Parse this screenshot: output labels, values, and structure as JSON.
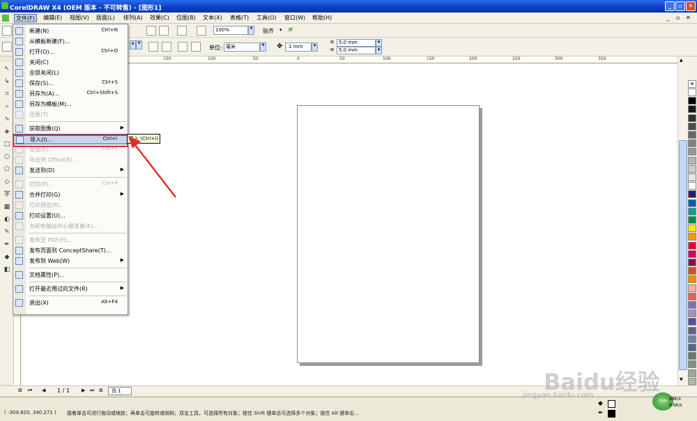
{
  "app": {
    "title": "CorelDRAW X4 (OEM 版本 - 不可转售) - [图形1]"
  },
  "menubar": [
    "文件(F)",
    "编辑(E)",
    "视图(V)",
    "版面(L)",
    "排列(A)",
    "效果(C)",
    "位图(B)",
    "文本(X)",
    "表格(T)",
    "工具(O)",
    "窗口(W)",
    "帮助(H)"
  ],
  "toolbar": {
    "zoom": "100%",
    "snap": "贴齐"
  },
  "propbar": {
    "unit_label": "单位:",
    "unit": "毫米",
    "nudge": ".1 mm",
    "dup_x": "5.0 mm",
    "dup_y": "5.0 mm"
  },
  "file_menu": [
    {
      "label": "新建(N)",
      "shortcut": "Ctrl+N",
      "enabled": true
    },
    {
      "label": "从模板新建(F)...",
      "shortcut": "",
      "enabled": true
    },
    {
      "label": "打开(O)...",
      "shortcut": "Ctrl+O",
      "enabled": true
    },
    {
      "label": "关闭(C)",
      "shortcut": "",
      "enabled": true
    },
    {
      "label": "全部关闭(L)",
      "shortcut": "",
      "enabled": true
    },
    {
      "label": "保存(S)...",
      "shortcut": "Ctrl+S",
      "enabled": true
    },
    {
      "label": "另存为(A)...",
      "shortcut": "Ctrl+Shift+S",
      "enabled": true
    },
    {
      "label": "另存为模板(M)...",
      "shortcut": "",
      "enabled": true
    },
    {
      "label": "还原(T)",
      "shortcut": "",
      "enabled": false
    },
    {
      "sep": true
    },
    {
      "label": "获取图像(Q)",
      "shortcut": "",
      "enabled": true,
      "submenu": true
    },
    {
      "label": "导入(I)...",
      "shortcut": "Ctrl+I",
      "enabled": true,
      "highlight": true
    },
    {
      "label": "导出(E)...",
      "shortcut": "Ctrl+E",
      "enabled": false
    },
    {
      "label": "导出到 Office(R)...",
      "shortcut": "",
      "enabled": false
    },
    {
      "label": "发送到(D)",
      "shortcut": "",
      "enabled": true,
      "submenu": true
    },
    {
      "sep": true
    },
    {
      "label": "打印(P)...",
      "shortcut": "Ctrl+P",
      "enabled": false
    },
    {
      "label": "合并打印(G)",
      "shortcut": "",
      "enabled": true,
      "submenu": true
    },
    {
      "label": "打印预览(R)...",
      "shortcut": "",
      "enabled": false
    },
    {
      "label": "打印设置(U)...",
      "shortcut": "",
      "enabled": true
    },
    {
      "label": "为彩色输出中心做准备(K)...",
      "shortcut": "",
      "enabled": false
    },
    {
      "sep": true
    },
    {
      "label": "发布至 PDF(H)...",
      "shortcut": "",
      "enabled": false
    },
    {
      "label": "发布页面到 ConceptShare(T)...",
      "shortcut": "",
      "enabled": true
    },
    {
      "label": "发布到 Web(W)",
      "shortcut": "",
      "enabled": true,
      "submenu": true
    },
    {
      "sep": true
    },
    {
      "label": "文档属性(P)...",
      "shortcut": "",
      "enabled": true
    },
    {
      "sep": true
    },
    {
      "label": "打开最近用过的文件(R)",
      "shortcut": "",
      "enabled": true,
      "submenu": true
    },
    {
      "sep": true
    },
    {
      "label": "退出(X)",
      "shortcut": "Alt+F4",
      "enabled": true
    }
  ],
  "tooltip": "导入 (Ctrl+I)",
  "ruler_ticks": [
    "150",
    "100",
    "50",
    "0",
    "50",
    "100",
    "150",
    "200",
    "250",
    "300",
    "350"
  ],
  "pager": {
    "position": "1 / 1",
    "tab": "页 1"
  },
  "status": {
    "coords": "( -304.820, 340.271 )",
    "hint": "接着单击可进行拖动或缩放；再单击可旋转或倾斜；双击工具，可选择所有对象；按住 Shift 键单击可选择多个对象；按住 Alt 键单击..."
  },
  "net": {
    "percent": "39%",
    "up": "98K/s",
    "down": "9.6K/s"
  },
  "watermark": {
    "logo": "Baidu经验",
    "url": "jingyan.baidu.com"
  },
  "palette_colors": [
    "#ffffff",
    "#000000",
    "#1a1a1a",
    "#333333",
    "#4d4d4d",
    "#666666",
    "#808080",
    "#999999",
    "#b3b3b3",
    "#cccccc",
    "#e6e6e6",
    "#ffffff",
    "#2e1a6e",
    "#0060b0",
    "#00a0a0",
    "#009040",
    "#ffe600",
    "#ff9900",
    "#e8003c",
    "#cc0066",
    "#7a1a4e",
    "#d95020",
    "#ff8800",
    "#f5b0a0",
    "#e06060",
    "#8070b0",
    "#a090c8",
    "#5050a0",
    "#606090",
    "#7080a8",
    "#4a6a8a",
    "#607870",
    "#809080",
    "#a0a890",
    "#b0b8a8"
  ]
}
